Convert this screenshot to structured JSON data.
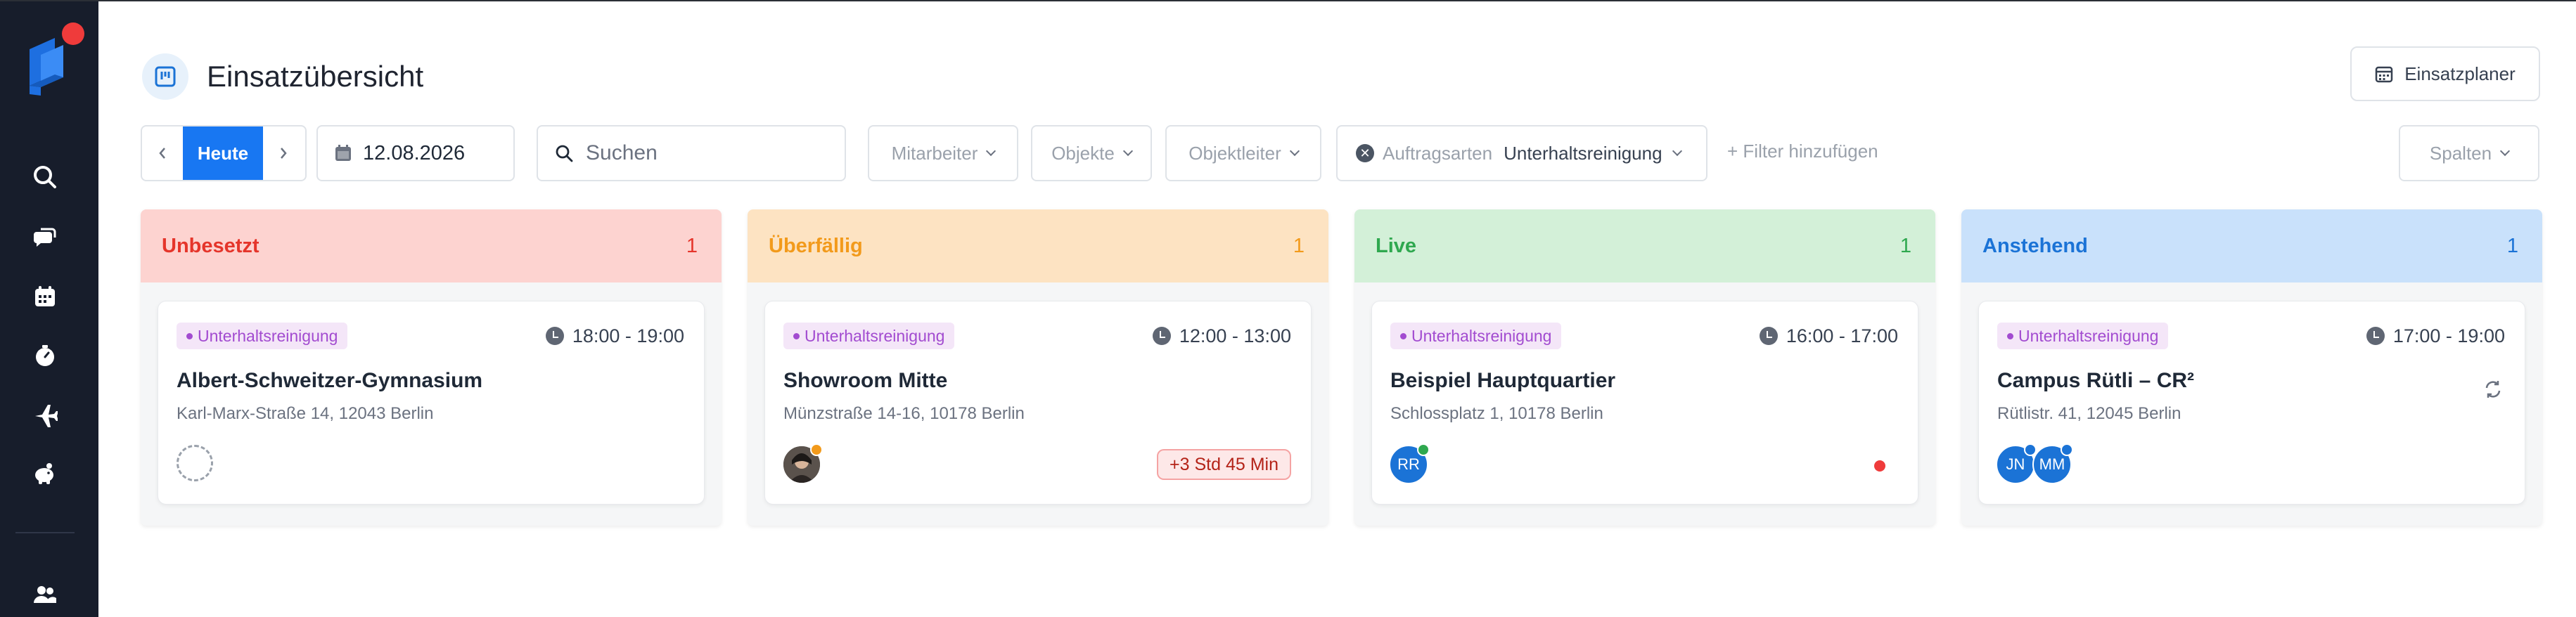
{
  "page": {
    "title": "Einsatzübersicht",
    "planner_button": "Einsatzplaner"
  },
  "sidebar": {
    "items": [
      {
        "icon": "search-icon"
      },
      {
        "icon": "chat-bubbles-icon"
      },
      {
        "icon": "calendar-icon"
      },
      {
        "icon": "stopwatch-icon"
      },
      {
        "icon": "airplane-icon"
      },
      {
        "icon": "piggy-bank-icon"
      },
      {
        "icon": "users-icon"
      }
    ]
  },
  "toolbar": {
    "today_label": "Heute",
    "date_value": "12.08.2026",
    "search_placeholder": "Suchen",
    "filters": {
      "employees": "Mitarbeiter",
      "objects": "Objekte",
      "object_managers": "Objektleiter"
    },
    "active_filter": {
      "label": "Auftragsarten",
      "value": "Unterhaltsreinigung"
    },
    "add_filter": "+ Filter hinzufügen",
    "columns_label": "Spalten"
  },
  "columns": [
    {
      "title": "Unbesetzt",
      "count": "1",
      "header_bg": "#fdd3d0",
      "header_color": "#e5352b",
      "card": {
        "tag": "Unterhaltsreinigung",
        "time": "18:00 - 19:00",
        "title": "Albert-Schweitzer-Gymnasium",
        "address": "Karl-Marx-Straße 14, 12043 Berlin"
      }
    },
    {
      "title": "Überfällig",
      "count": "1",
      "header_bg": "#fde3c2",
      "header_color": "#f29a1b",
      "card": {
        "tag": "Unterhaltsreinigung",
        "time": "12:00 - 13:00",
        "title": "Showroom Mitte",
        "address": "Münzstraße 14-16, 10178 Berlin",
        "overdue": "+3 Std 45 Min"
      }
    },
    {
      "title": "Live",
      "count": "1",
      "header_bg": "#d3f0d8",
      "header_color": "#2fa84f",
      "card": {
        "tag": "Unterhaltsreinigung",
        "time": "16:00 - 17:00",
        "title": "Beispiel Hauptquartier",
        "address": "Schlossplatz 1, 10178 Berlin",
        "avatar": "RR"
      }
    },
    {
      "title": "Anstehend",
      "count": "1",
      "header_bg": "#c9e1fb",
      "header_color": "#1b73d6",
      "card": {
        "tag": "Unterhaltsreinigung",
        "time": "17:00 - 19:00",
        "title": "Campus Rütli – CR²",
        "address": "Rütlistr. 41, 12045 Berlin",
        "avatars": [
          "JN",
          "MM"
        ]
      }
    }
  ],
  "colors": {
    "accent": "#1877f2",
    "sidebar_bg": "#171d2b",
    "notification": "#ef3b3b"
  }
}
